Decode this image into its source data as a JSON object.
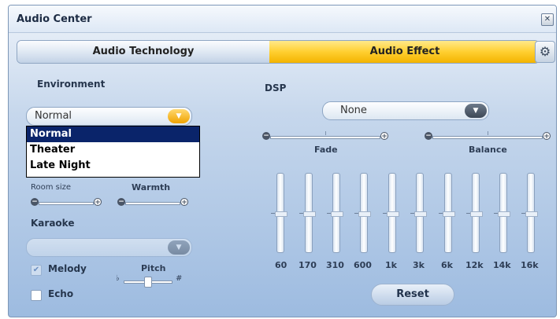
{
  "window": {
    "title": "Audio Center",
    "close_icon": "close-icon"
  },
  "tabs": [
    {
      "label": "Audio Technology",
      "active": false
    },
    {
      "label": "Audio Effect",
      "active": true
    }
  ],
  "settings_icon": "gear-icon",
  "environment": {
    "label": "Environment",
    "selected": "Normal",
    "options": [
      "Normal",
      "Theater",
      "Late Night"
    ],
    "room_size_label": "Room size",
    "warmth_label": "Warmth"
  },
  "karaoke": {
    "label": "Karaoke",
    "melody_label": "Melody",
    "melody_checked": true,
    "pitch_label": "Pitch",
    "pitch_flat": "♭",
    "pitch_sharp": "#",
    "echo_label": "Echo",
    "echo_checked": false
  },
  "dsp": {
    "label": "DSP",
    "selected": "None",
    "fade_label": "Fade",
    "balance_label": "Balance"
  },
  "equalizer": {
    "bands": [
      "60",
      "170",
      "310",
      "600",
      "1k",
      "3k",
      "6k",
      "12k",
      "14k",
      "16k"
    ]
  },
  "reset_label": "Reset",
  "colors": {
    "accent": "#ffcf30",
    "selection": "#0a246a"
  }
}
